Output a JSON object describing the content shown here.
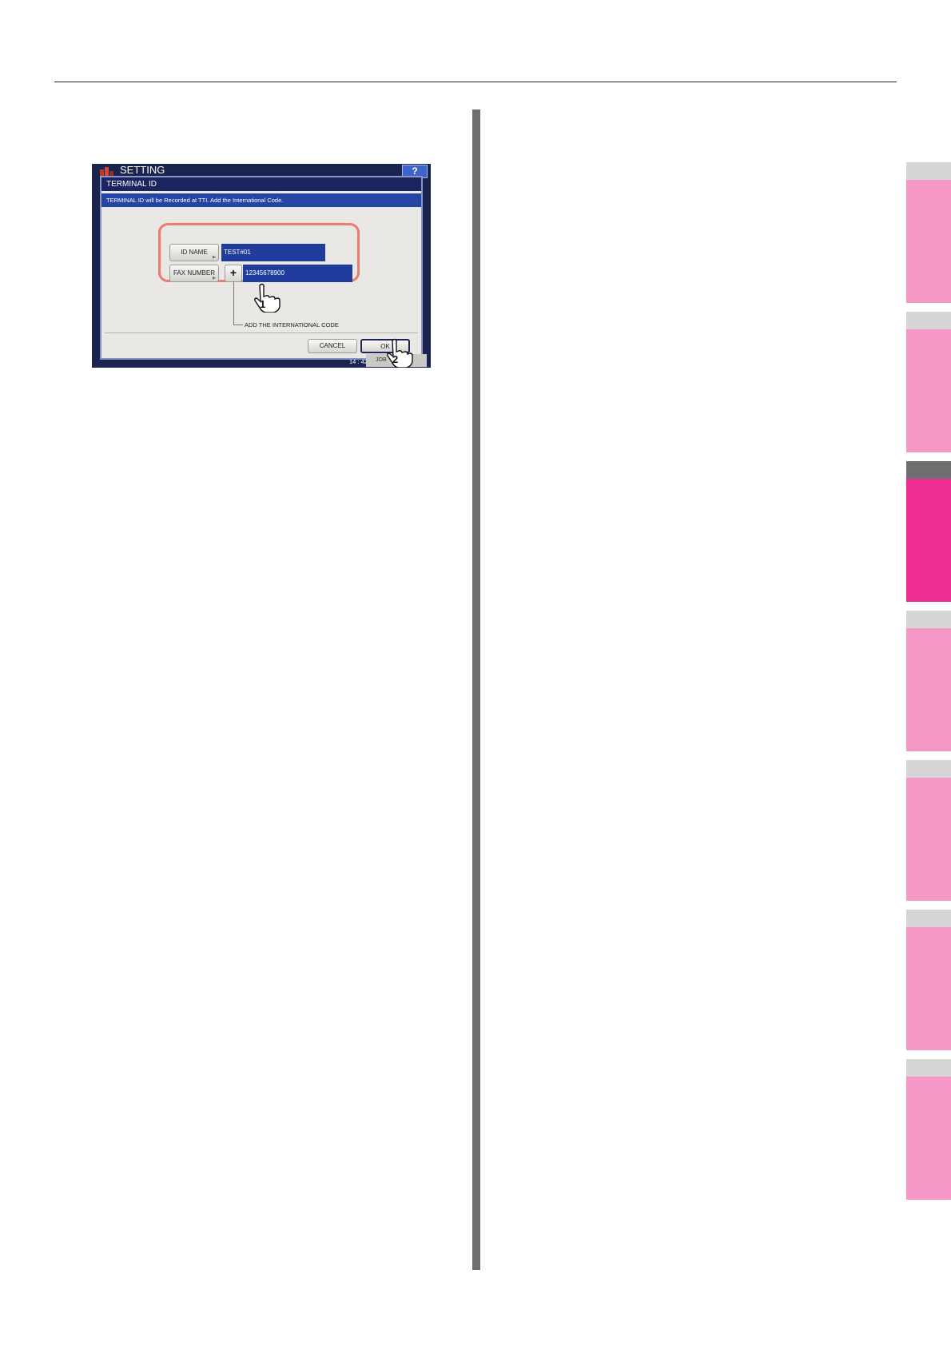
{
  "screen": {
    "app_title": "SETTING",
    "help_label": "?",
    "dialog_title": "TERMINAL ID",
    "banner": "TERMINAL ID will be Recorded at TTI. Add the International Code.",
    "fields": [
      {
        "label": "ID NAME",
        "value": "TEST#01"
      },
      {
        "label": "FAX NUMBER",
        "value": "12345678900"
      }
    ],
    "plus_label": "+",
    "callout": "ADD THE INTERNATIONAL CODE",
    "cancel_label": "CANCEL",
    "ok_label": "OK",
    "time": "14 : 42",
    "job_label": "JOB",
    "step_markers": [
      "1",
      "2"
    ]
  },
  "colors": {
    "accent_pink": "#ee2e93",
    "tab_pink": "#f598c6",
    "highlight": "#ef7a6e",
    "screen_blue": "#203d9e"
  }
}
